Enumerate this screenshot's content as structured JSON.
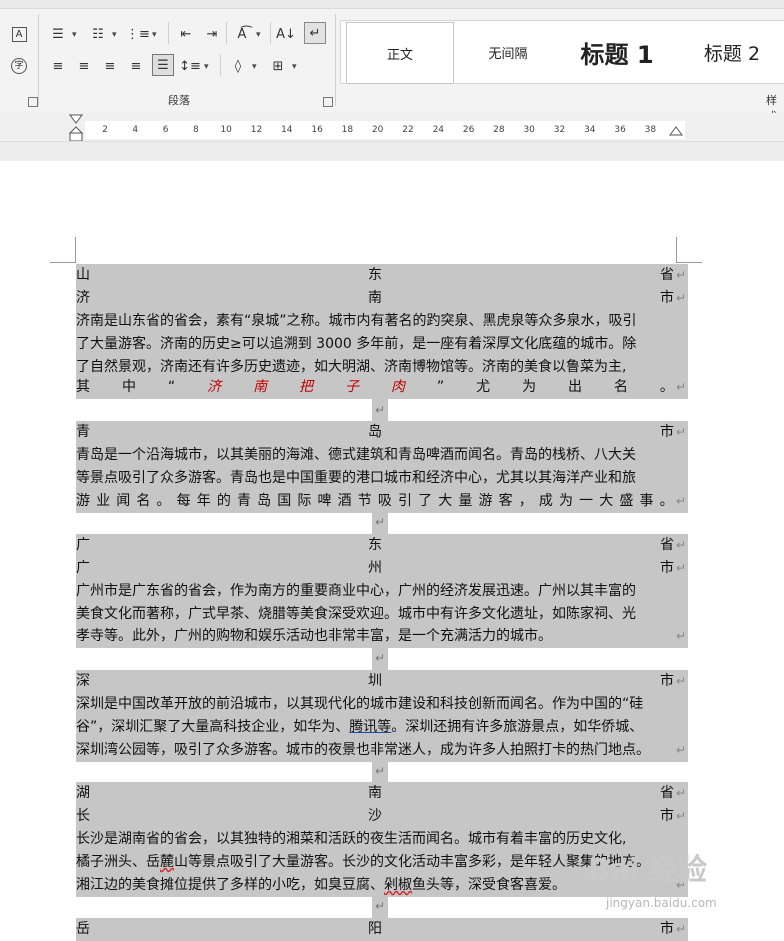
{
  "ribbon": {
    "group_paragraph_label": "段落",
    "group_styles_label": "样式",
    "styles": [
      {
        "label": "正文",
        "selected": true
      },
      {
        "label": "无间隔",
        "selected": false
      },
      {
        "label": "标题 1",
        "selected": false
      },
      {
        "label": "标题 2",
        "selected": false
      }
    ]
  },
  "ruler": {
    "ticks": [
      "2",
      "4",
      "6",
      "8",
      "10",
      "12",
      "14",
      "16",
      "18",
      "20",
      "22",
      "24",
      "26",
      "28",
      "30",
      "32",
      "34",
      "36",
      "38"
    ]
  },
  "doc": {
    "pilcrow": "↵",
    "sec1": {
      "h1": [
        "山",
        "东",
        "省"
      ],
      "h2": [
        "济",
        "南",
        "市"
      ],
      "p1": "济南是山东省的省会，素有“泉城”之称。城市内有著名的趵突泉、黑虎泉等众多泉水，吸引",
      "p2": "了大量游客。济南的历史≥可以追溯到 3000 多年前，是一座有着深厚文化底蕴的城市。除",
      "p3": "了自然景观，济南还有许多历史遗迹，如大明湖、济南博物馆等。济南的美食以鲁菜为主,",
      "p4a": [
        "其",
        "中",
        "“"
      ],
      "p4red": [
        "济",
        "南",
        "把",
        "子",
        "肉"
      ],
      "p4b": [
        "”",
        "尤",
        "为",
        "出",
        "名",
        "。"
      ]
    },
    "sec2": {
      "h1": [
        "青",
        "岛",
        "市"
      ],
      "p1": "青岛是一个沿海城市，以其美丽的海滩、德式建筑和青岛啤酒而闻名。青岛的栈桥、八大关",
      "p2": "等景点吸引了众多游客。青岛也是中国重要的港口城市和经济中心，尤其以其海洋产业和旅",
      "p3": [
        "游",
        "业",
        "闻",
        "名",
        "。",
        "每",
        "年",
        "的",
        "青",
        "岛",
        "国",
        "际",
        "啤",
        "酒",
        "节",
        "吸",
        "引",
        "了",
        "大",
        "量",
        "游",
        "客",
        "，",
        "成",
        "为",
        "一",
        "大",
        "盛",
        "事",
        "。"
      ]
    },
    "sec3": {
      "h1": [
        "广",
        "东",
        "省"
      ],
      "h2": [
        "广",
        "州",
        "市"
      ],
      "p1": "广州市是广东省的省会，作为南方的重要商业中心，广州的经济发展迅速。广州以其丰富的",
      "p2": "美食文化而著称，广式早茶、烧腊等美食深受欢迎。城市中有许多文化遗址，如陈家祠、光",
      "p3": "孝寺等。此外，广州的购物和娱乐活动也非常丰富，是一个充满活力的城市。"
    },
    "sec4": {
      "h1": [
        "深",
        "圳",
        "市"
      ],
      "p1": "深圳是中国改革开放的前沿城市，以其现代化的城市建设和科技创新而闻名。作为中国的“硅",
      "p2a": "谷”，深圳汇聚了大量高科技企业，如华为、",
      "p2link": "腾讯等",
      "p2b": "。深圳还拥有许多旅游景点，如华侨城、",
      "p3": "深圳湾公园等，吸引了众多游客。城市的夜景也非常迷人，成为许多人拍照打卡的热门地点。"
    },
    "sec5": {
      "h1": [
        "湖",
        "南",
        "省"
      ],
      "h2": [
        "长",
        "沙",
        "市"
      ],
      "p1": "长沙是湖南省的省会，以其独特的湘菜和活跃的夜生活而闻名。城市有着丰富的历史文化,",
      "p2a": "橘子洲头、岳",
      "p2sq": "麓",
      "p2b": "山等景点吸引了大量游客。长沙的文化活动丰富多彩，是年轻人聚集的地方。",
      "p3a": "湘江边的美食摊位提供了多样的小吃，如臭豆腐、",
      "p3sq": "剁椒",
      "p3b": "鱼头等，深受食客喜爱。"
    },
    "sec6": {
      "h1": [
        "岳",
        "阳",
        "市"
      ]
    }
  },
  "watermark": {
    "text": "Bai 经验",
    "sub": "jingyan.baidu.com"
  }
}
